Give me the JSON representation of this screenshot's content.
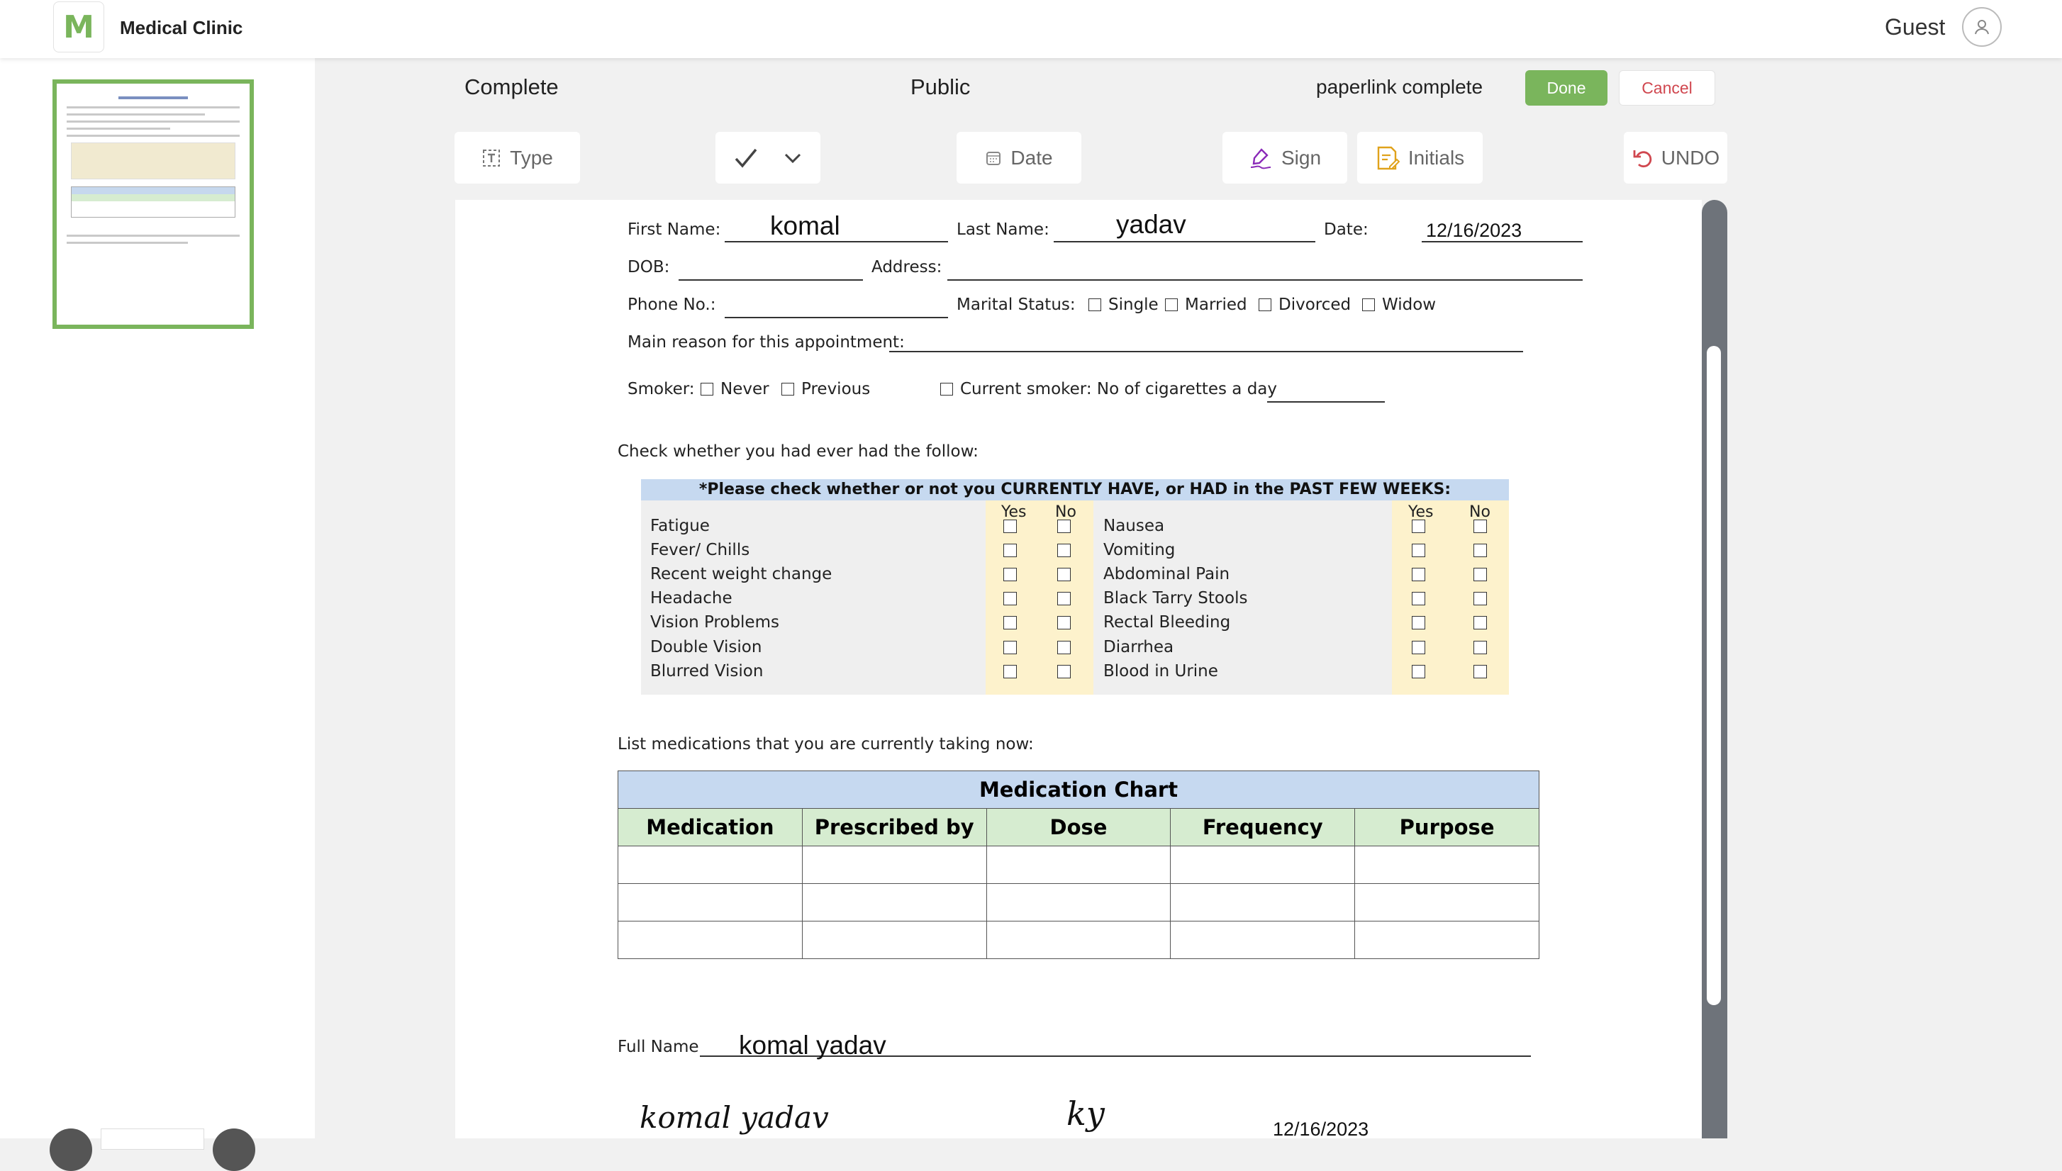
{
  "app": {
    "title": "Medical Clinic",
    "logo_letter": "M",
    "user": "Guest"
  },
  "header": {
    "status": "Complete",
    "visibility": "Public",
    "paperlink_status": "paperlink complete",
    "done_label": "Done",
    "cancel_label": "Cancel"
  },
  "toolbar": {
    "type_label": "Type",
    "date_label": "Date",
    "sign_label": "Sign",
    "initials_label": "Initials",
    "undo_label": "UNDO"
  },
  "form": {
    "first_name_label": "First Name:",
    "first_name": "komal",
    "last_name_label": "Last Name:",
    "last_name": "yadav",
    "date_label": "Date:",
    "date": "12/16/2023",
    "dob_label": "DOB:",
    "address_label": "Address:",
    "phone_label": "Phone No.:",
    "marital_label": "Marital Status:",
    "marital_options": [
      "Single",
      "Married",
      "Divorced",
      "Widow"
    ],
    "reason_label": "Main reason for this appointment:",
    "smoker_label": "Smoker:",
    "smoker_options": [
      "Never",
      "Previous",
      "Current smoker: No of cigarettes a day"
    ],
    "symptoms_intro": "Check whether you had ever had the follow:",
    "symptoms_header": "*Please check whether or not you CURRENTLY HAVE, or HAD in the PAST FEW WEEKS:",
    "yes_label": "Yes",
    "no_label": "No",
    "symptoms_left": [
      "Fatigue",
      "Fever/ Chills",
      "Recent weight change",
      "Headache",
      "Vision Problems",
      "Double Vision",
      "Blurred Vision"
    ],
    "symptoms_right": [
      "Nausea",
      "Vomiting",
      "Abdominal Pain",
      "Black Tarry Stools",
      "Rectal Bleeding",
      "Diarrhea",
      "Blood in Urine"
    ],
    "medications_intro": "List medications that you are currently taking now:",
    "medication_chart_title": "Medication Chart",
    "medication_columns": [
      "Medication",
      "Prescribed by",
      "Dose",
      "Frequency",
      "Purpose"
    ],
    "full_name_label": "Full Name",
    "full_name": "komal yadav",
    "signature": "komal yadav",
    "initials": "ky",
    "signed_date": "12/16/2023"
  },
  "colors": {
    "accent": "#7ab55c",
    "cancel": "#d0474f",
    "table_header_blue": "#c6d9f0",
    "table_header_green": "#d6ecd0",
    "yes_no_bg": "#fdf2cc"
  }
}
